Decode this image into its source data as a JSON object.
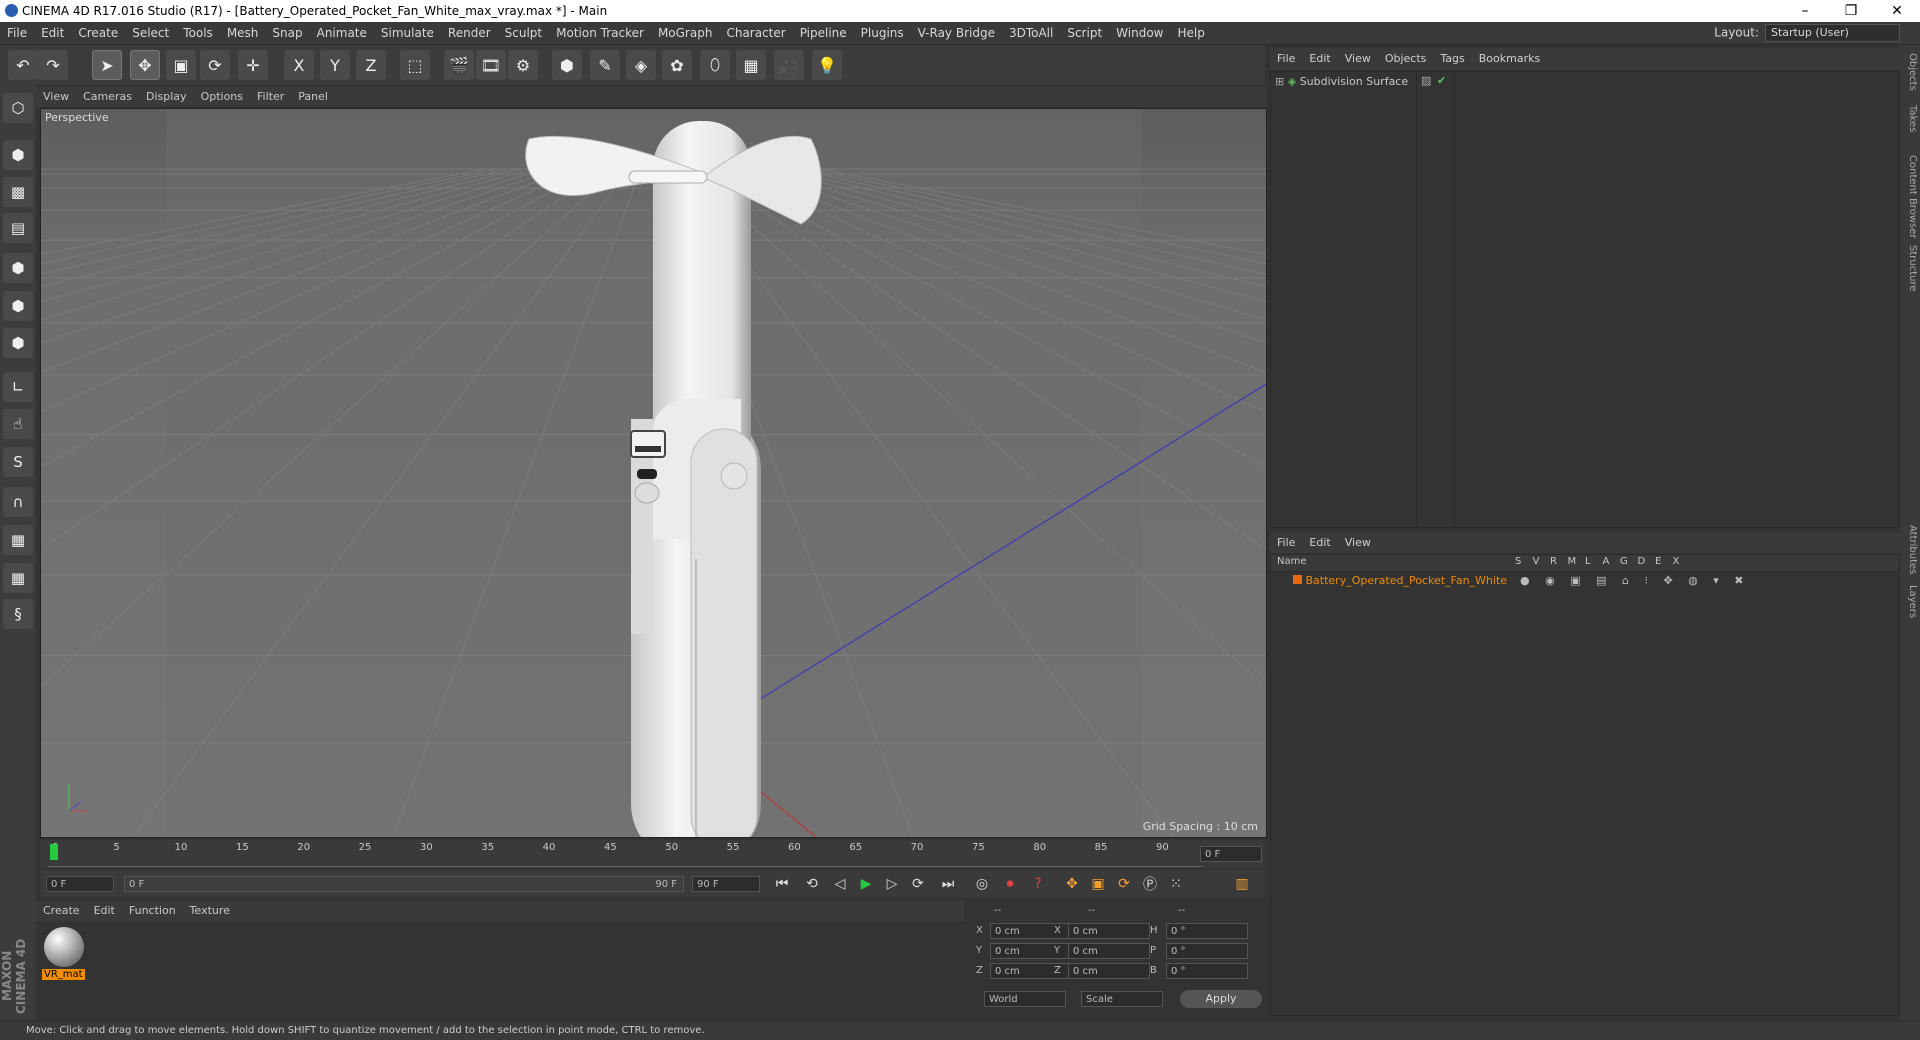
{
  "window": {
    "title": "CINEMA 4D R17.016 Studio (R17) - [Battery_Operated_Pocket_Fan_White_max_vray.max *] - Main",
    "minimize": "–",
    "restore": "❐",
    "close": "✕"
  },
  "menu": [
    "File",
    "Edit",
    "Create",
    "Select",
    "Tools",
    "Mesh",
    "Snap",
    "Animate",
    "Simulate",
    "Render",
    "Sculpt",
    "Motion Tracker",
    "MoGraph",
    "Character",
    "Pipeline",
    "Plugins",
    "V-Ray Bridge",
    "3DToAll",
    "Script",
    "Window",
    "Help"
  ],
  "layout": {
    "label": "Layout:",
    "value": "Startup (User)"
  },
  "toolbar": [
    {
      "name": "undo-icon",
      "glyph": "↶"
    },
    {
      "name": "redo-icon",
      "glyph": "↷"
    },
    {
      "name": "select-arrow-icon",
      "glyph": "➤"
    },
    {
      "name": "move-icon",
      "glyph": "✥"
    },
    {
      "name": "scale-icon",
      "glyph": "▣"
    },
    {
      "name": "rotate-icon",
      "glyph": "⟳"
    },
    {
      "name": "transform-icon",
      "glyph": "✛"
    },
    {
      "name": "x-axis-icon",
      "glyph": "X"
    },
    {
      "name": "y-axis-icon",
      "glyph": "Y"
    },
    {
      "name": "z-axis-icon",
      "glyph": "Z"
    },
    {
      "name": "coordinate-system-icon",
      "glyph": "⬚"
    },
    {
      "name": "render-view-icon",
      "glyph": "🎬"
    },
    {
      "name": "render-picture-icon",
      "glyph": "🎞"
    },
    {
      "name": "render-settings-icon",
      "glyph": "⚙"
    },
    {
      "name": "cube-icon",
      "glyph": "⬢"
    },
    {
      "name": "pen-spline-icon",
      "glyph": "✎"
    },
    {
      "name": "subdivision-icon",
      "glyph": "◈"
    },
    {
      "name": "mograph-cloner-icon",
      "glyph": "✿"
    },
    {
      "name": "deformer-icon",
      "glyph": "⬯"
    },
    {
      "name": "floor-icon",
      "glyph": "▦"
    },
    {
      "name": "camera-icon",
      "glyph": "🎥"
    },
    {
      "name": "light-icon",
      "glyph": "💡"
    }
  ],
  "lefttools": [
    {
      "name": "make-editable-icon",
      "glyph": "⬡"
    },
    {
      "name": "model-mode-icon",
      "glyph": "⬢"
    },
    {
      "name": "texture-mode-icon",
      "glyph": "▩"
    },
    {
      "name": "workplane-icon",
      "glyph": "▤"
    },
    {
      "name": "points-mode-icon",
      "glyph": "⬢"
    },
    {
      "name": "edges-mode-icon",
      "glyph": "⬢"
    },
    {
      "name": "polygons-mode-icon",
      "glyph": "⬢"
    },
    {
      "name": "axis-mode-icon",
      "glyph": "∟"
    },
    {
      "name": "tweak-mode-icon",
      "glyph": "☝"
    },
    {
      "name": "solo-icon",
      "glyph": "S"
    },
    {
      "name": "snap-magnet-icon",
      "glyph": "∩"
    },
    {
      "name": "grid-lock-icon",
      "glyph": "▦"
    },
    {
      "name": "grid-snap-icon",
      "glyph": "▦"
    },
    {
      "name": "python-icon",
      "glyph": "§"
    }
  ],
  "viewport": {
    "menu": [
      "View",
      "Cameras",
      "Display",
      "Options",
      "Filter",
      "Panel"
    ],
    "label": "Perspective",
    "grid_spacing": "Grid Spacing : 10 cm"
  },
  "timeline": {
    "ticks": [
      "0",
      "5",
      "10",
      "15",
      "20",
      "25",
      "30",
      "35",
      "40",
      "45",
      "50",
      "55",
      "60",
      "65",
      "70",
      "75",
      "80",
      "85",
      "90"
    ],
    "current_frame": "0 F",
    "start_field": "0 F",
    "range_start": "0 F",
    "range_end": "90 F",
    "end_field": "90 F"
  },
  "material_manager": {
    "menu": [
      "Create",
      "Edit",
      "Function",
      "Texture"
    ],
    "materials": [
      {
        "name": "VR_mat"
      }
    ]
  },
  "coordinates": {
    "headers": [
      "--",
      "--",
      "--"
    ],
    "rows": [
      {
        "a": "X",
        "av": "0 cm",
        "b": "X",
        "bv": "0 cm",
        "c": "H",
        "cv": "0 °"
      },
      {
        "a": "Y",
        "av": "0 cm",
        "b": "Y",
        "bv": "0 cm",
        "c": "P",
        "cv": "0 °"
      },
      {
        "a": "Z",
        "av": "0 cm",
        "b": "Z",
        "bv": "0 cm",
        "c": "B",
        "cv": "0 °"
      }
    ],
    "world": "World",
    "scale": "Scale",
    "apply": "Apply"
  },
  "object_manager": {
    "menu": [
      "File",
      "Edit",
      "View",
      "Objects",
      "Tags",
      "Bookmarks"
    ],
    "objects": [
      {
        "name": "Subdivision Surface"
      }
    ]
  },
  "layer_manager": {
    "menu": [
      "File",
      "Edit",
      "View"
    ],
    "columns": [
      "Name",
      "S",
      "V",
      "R",
      "M",
      "L",
      "A",
      "G",
      "D",
      "E",
      "X"
    ],
    "layers": [
      {
        "name": "Battery_Operated_Pocket_Fan_White"
      }
    ]
  },
  "side_tabs": [
    "Objects",
    "Takes",
    "Content Browser",
    "Structure",
    "Attributes",
    "Layers"
  ],
  "status": "Move: Click and drag to move elements. Hold down SHIFT to quantize movement / add to the selection in point mode, CTRL to remove.",
  "brand": "MAXON CINEMA 4D",
  "colors": {
    "accent_orange": "#f08c00",
    "playhead_green": "#27c93f",
    "layer_orange": "#e86a10"
  }
}
